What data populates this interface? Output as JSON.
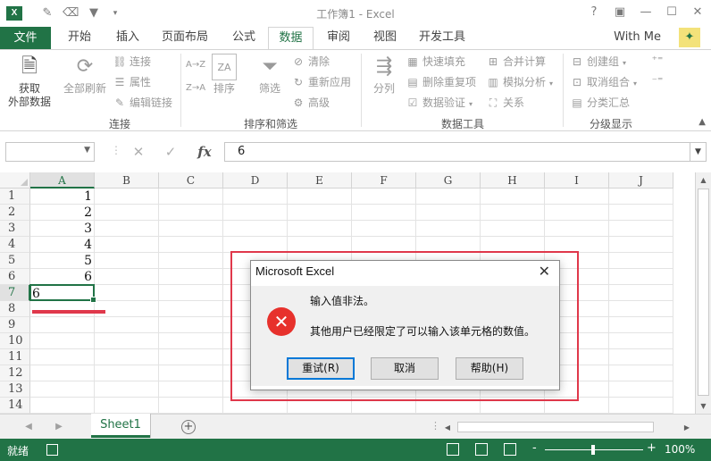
{
  "titlebar": {
    "title": "工作簿1 - Excel",
    "help": "?",
    "restore": "▣",
    "minimize": "—",
    "maximize": "☐",
    "close": "✕"
  },
  "tabs": {
    "file": "文件",
    "items": [
      "开始",
      "插入",
      "页面布局",
      "公式",
      "数据",
      "审阅",
      "视图",
      "开发工具"
    ],
    "active": "数据",
    "user": "With Me"
  },
  "ribbon": {
    "get_external": "获取\n外部数据",
    "refresh_all": "全部刷新",
    "connections": "连接",
    "properties": "属性",
    "edit_links": "编辑链接",
    "group_connections": "连接",
    "sort_az": "A→Z",
    "sort_za": "Z→A",
    "sort": "排序",
    "filter": "筛选",
    "clear": "清除",
    "reapply": "重新应用",
    "advanced": "高级",
    "group_sort": "排序和筛选",
    "text_to_columns": "分列",
    "flash_fill": "快速填充",
    "remove_duplicates": "删除重复项",
    "data_validation": "数据验证",
    "consolidate": "合并计算",
    "what_if": "模拟分析",
    "relationships": "关系",
    "group_data_tools": "数据工具",
    "group": "创建组",
    "ungroup": "取消组合",
    "subtotal": "分类汇总",
    "group_outline": "分级显示"
  },
  "formula_bar": {
    "name_box": "",
    "cancel": "✕",
    "enter": "✓",
    "fx": "fx",
    "value": "6"
  },
  "grid": {
    "columns": [
      "A",
      "B",
      "C",
      "D",
      "E",
      "F",
      "G",
      "H",
      "I",
      "J"
    ],
    "rows": [
      "1",
      "2",
      "3",
      "4",
      "5",
      "6",
      "7",
      "8",
      "9",
      "10",
      "11",
      "12",
      "13",
      "14"
    ],
    "column_a_values": [
      "1",
      "2",
      "3",
      "4",
      "5",
      "6",
      "6"
    ],
    "selected_column": "A",
    "selected_row": "7"
  },
  "sheets": {
    "tabs": [
      "Sheet1"
    ],
    "active": "Sheet1",
    "add": "+"
  },
  "status": {
    "ready": "就绪",
    "zoom": "100%",
    "zoom_minus": "-",
    "zoom_plus": "+"
  },
  "dialog": {
    "title": "Microsoft Excel",
    "close": "✕",
    "icon": "error-icon",
    "message1": "输入值非法。",
    "message2": "其他用户已经限定了可以输入该单元格的数值。",
    "retry": "重试(R)",
    "cancel": "取消",
    "help": "帮助(H)"
  },
  "colors": {
    "excel_green": "#217346",
    "error_red": "#e7312c",
    "annotation_red": "#e0384b",
    "primary_button_border": "#0078d7"
  }
}
